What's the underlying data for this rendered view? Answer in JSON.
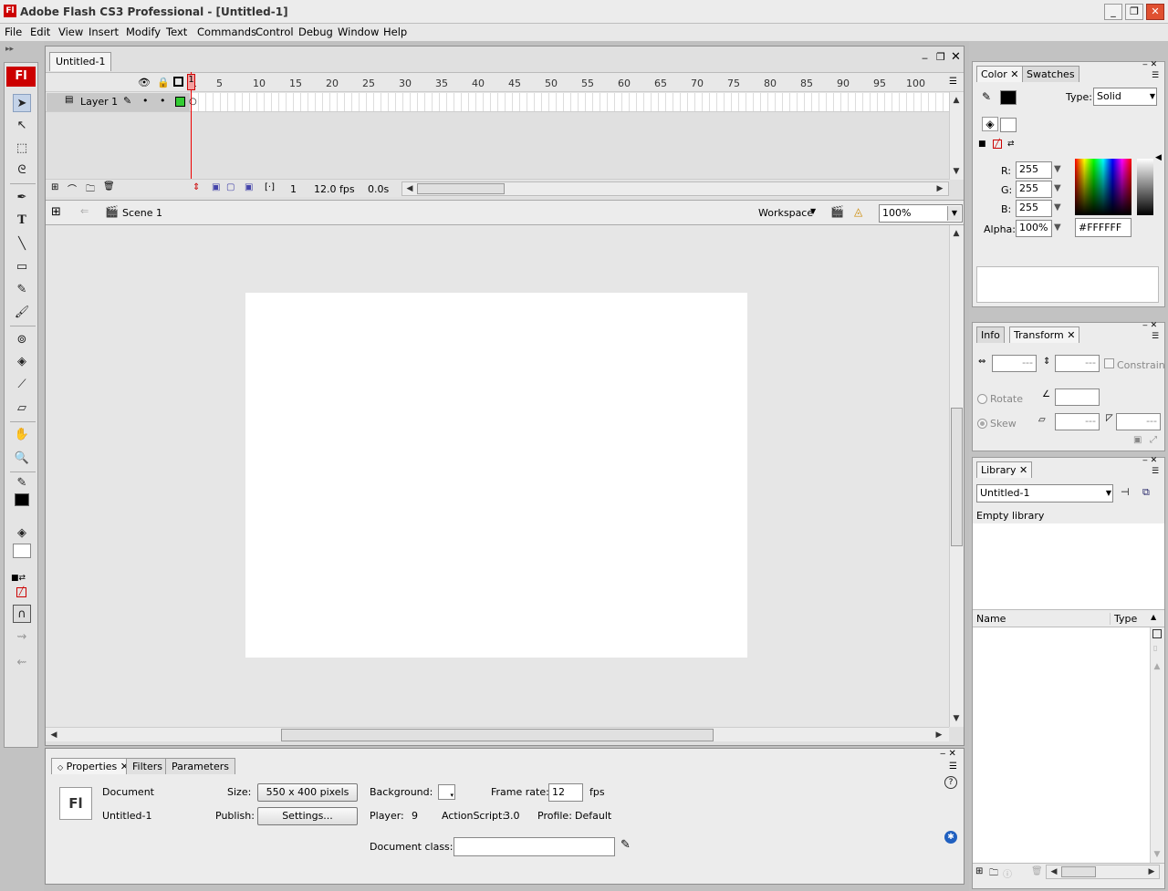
{
  "window": {
    "title": "Adobe Flash CS3 Professional - [Untitled-1]",
    "app_icon": "Fl"
  },
  "menu": [
    "File",
    "Edit",
    "View",
    "Insert",
    "Modify",
    "Text",
    "Commands",
    "Control",
    "Debug",
    "Window",
    "Help"
  ],
  "tools_logo": "Fl",
  "document": {
    "tab": "Untitled-1",
    "ruler": [
      "1",
      "5",
      "10",
      "15",
      "20",
      "25",
      "30",
      "35",
      "40",
      "45",
      "50",
      "55",
      "60",
      "65",
      "70",
      "75",
      "80",
      "85",
      "90",
      "95",
      "100"
    ],
    "layer": "Layer 1",
    "status": {
      "frame": "1",
      "fps": "12.0 fps",
      "time": "0.0s"
    },
    "scene": "Scene 1",
    "workspace": "Workspace",
    "zoom": "100%"
  },
  "properties": {
    "tabs": [
      "Properties",
      "Filters",
      "Parameters"
    ],
    "doc_icon": "Fl",
    "doc_label": "Document",
    "doc_name": "Untitled-1",
    "size_label": "Size:",
    "size_value": "550 x 400 pixels",
    "publish_label": "Publish:",
    "settings_button": "Settings...",
    "background_label": "Background:",
    "framerate_label": "Frame rate:",
    "framerate_value": "12",
    "fps_unit": "fps",
    "player_label": "Player:",
    "player_value": "9",
    "actionscript_label": "ActionScript:",
    "actionscript_value": "3.0",
    "profile_label": "Profile:",
    "profile_value": "Default",
    "docclass_label": "Document class:",
    "docclass_value": ""
  },
  "color_panel": {
    "tabs": [
      "Color",
      "Swatches"
    ],
    "type_label": "Type:",
    "type_value": "Solid",
    "r_label": "R:",
    "r_value": "255",
    "g_label": "G:",
    "g_value": "255",
    "b_label": "B:",
    "b_value": "255",
    "alpha_label": "Alpha:",
    "alpha_value": "100%",
    "hex_value": "#FFFFFF"
  },
  "transform_panel": {
    "tabs": [
      "Info",
      "Transform"
    ],
    "w_value": "---",
    "h_value": "---",
    "constrain": "Constrain",
    "rotate": "Rotate",
    "skew": "Skew",
    "rotate_value": "",
    "skew_h": "---",
    "skew_v": "---"
  },
  "library_panel": {
    "tab": "Library",
    "doc_select": "Untitled-1",
    "status": "Empty library",
    "col_name": "Name",
    "col_type": "Type"
  },
  "colors": {
    "accent_red": "#cc0000",
    "stage": "#ffffff",
    "layer_green": "#33cc33"
  }
}
